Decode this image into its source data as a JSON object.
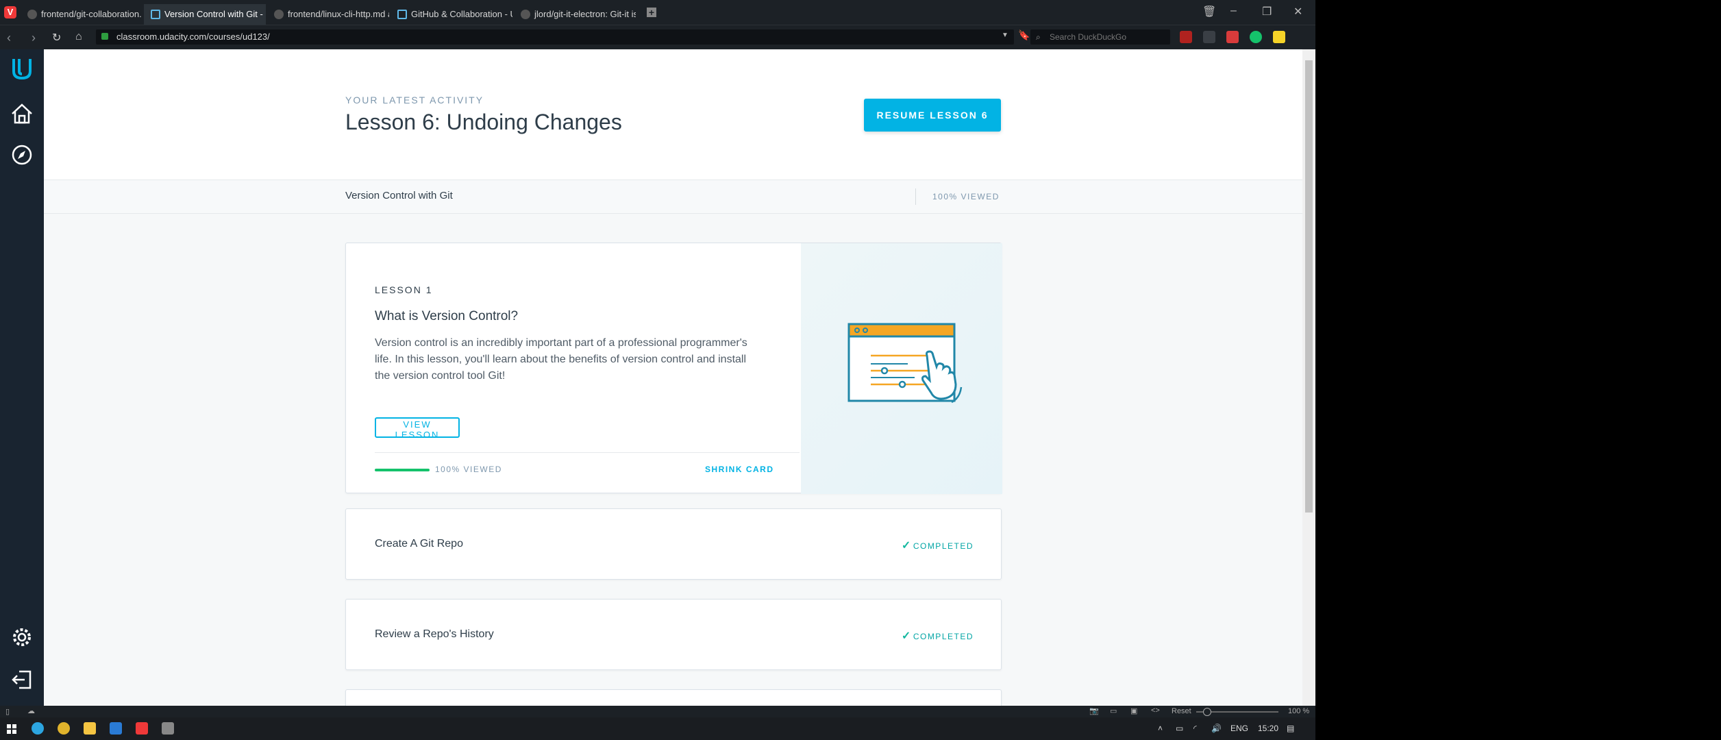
{
  "browser": {
    "tabs": [
      {
        "label": "frontend/git-collaboration.",
        "active": false
      },
      {
        "label": "Version Control with Git - U",
        "active": true
      },
      {
        "label": "frontend/linux-cli-http.md a",
        "active": false
      },
      {
        "label": "GitHub & Collaboration - U",
        "active": false
      },
      {
        "label": "jlord/git-it-electron: Git-it is",
        "active": false
      }
    ],
    "url": "classroom.udacity.com/courses/ud123/",
    "search_placeholder": "Search DuckDuckGo",
    "zoom": "100 %",
    "reset_label": "Reset"
  },
  "hero": {
    "eyebrow": "YOUR LATEST ACTIVITY",
    "title": "Lesson 6: Undoing Changes",
    "resume_label": "RESUME LESSON 6"
  },
  "subbar": {
    "course": "Version Control with Git",
    "viewed": "100% VIEWED"
  },
  "main_card": {
    "number": "LESSON 1",
    "title": "What is Version Control?",
    "description": "Version control is an incredibly important part of a professional programmer's life. In this lesson, you'll learn about the benefits of version control and install the version control tool Git!",
    "view_label": "VIEW LESSON",
    "progress": 1.0,
    "progress_text": "100% VIEWED",
    "shrink_label": "SHRINK CARD"
  },
  "lessons": [
    {
      "title": "Create A Git Repo",
      "status": "COMPLETED"
    },
    {
      "title": "Review a Repo's History",
      "status": "COMPLETED"
    }
  ],
  "taskbar": {
    "lang": "ENG",
    "time": "15:20"
  },
  "colors": {
    "accent": "#02b3e4",
    "sidebar": "#192430",
    "progress": "#15c26b",
    "illustration_orange": "#f5a623"
  }
}
